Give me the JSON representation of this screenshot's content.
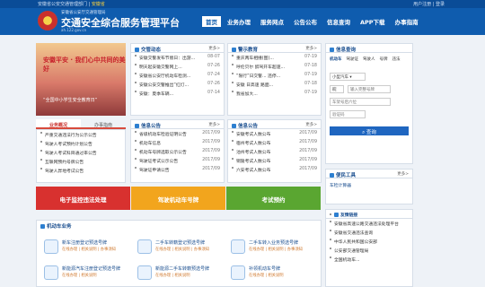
{
  "topbar": {
    "left_prefix": "安徽省公安交通管理部门",
    "left_highlight": "安徽省",
    "right": "用户注册 | 登录"
  },
  "header": {
    "sub": "安徽省公安厅交通管理局",
    "title": "交通安全综合服务管理平台",
    "url": "ah.122.gov.cn"
  },
  "nav": [
    "首页",
    "业务办理",
    "服务网点",
    "公告公布",
    "信息查询",
    "APP下载",
    "办事指南"
  ],
  "banner": {
    "main": "安徽平安 · 我们心中共同的美好",
    "sub": "“全国中小学生安全教育日”"
  },
  "tabs": [
    "业务概况",
    "办事指南"
  ],
  "panels": {
    "news": {
      "title": "交管动态",
      "more": "更多>",
      "items": [
        [
          "安徽交警发布节假日：出游...",
          "08-07"
        ],
        [
          "明天起安徽交警网上...",
          "07-26"
        ],
        [
          "安徽省公安厅机动车检测...",
          "07-24"
        ],
        [
          "安徽公安交警推出“红灯...",
          "07-26"
        ],
        [
          "安徽：夏季车辆...",
          "07-14"
        ]
      ]
    },
    "warn": {
      "title": "警示教育",
      "more": "更多>",
      "items": [
        [
          "重庆两车相撞(图)...",
          "07-19"
        ],
        [
          "呼伦贝尔 醉驾开车超速...",
          "07-18"
        ],
        [
          "“限行”日交警... 违停...",
          "07-19"
        ],
        [
          "安徽 日高速 路面...",
          "07-18"
        ],
        [
          "我省加大...",
          "07-19"
        ]
      ]
    },
    "notice_left": {
      "items": [
        [
          "严重交通违法行为公示公告",
          "2017/09"
        ],
        [
          "驾驶人考试预约计划公告",
          "2017/09"
        ],
        [
          "驾驶人考试科目通过率公告",
          "2017/09"
        ],
        [
          "互联网预约号牌公告",
          "2017/09"
        ],
        [
          "驾驶人异地考试公告",
          "2017/09"
        ]
      ]
    },
    "info": {
      "title": "信息公告",
      "more": "更多>",
      "items": [
        [
          "省级机动车检验证明公告",
          "2017/09"
        ],
        [
          "机动车信息",
          "2017/09"
        ],
        [
          "机动车号牌选取公示公告",
          "2017/09"
        ],
        [
          "驾驶证考试公示公告",
          "2017/09"
        ],
        [
          "驾驶证申请公告",
          "2017/09"
        ]
      ]
    },
    "info2": {
      "title": "信息公告",
      "more": "更多>",
      "items": [
        [
          "安徽考试人数公布",
          "2017/09"
        ],
        [
          "宿州考试人数公布",
          "2017/09"
        ],
        [
          "池州考试人数公布",
          "2017/09"
        ],
        [
          "铜陵考试人数公布",
          "2017/09"
        ],
        [
          "六安考试人数公布",
          "2017/09"
        ]
      ]
    }
  },
  "bars": [
    {
      "label": "电子监控违法处理",
      "color": "#d8312f"
    },
    {
      "label": "驾驶机动车号牌",
      "color": "#f2a51d"
    },
    {
      "label": "考试预约",
      "color": "#5aa631"
    }
  ],
  "query": {
    "title": "信息查询",
    "tabs": [
      "机动车",
      "驾驶证",
      "驾驶人",
      "号牌",
      "违法"
    ],
    "select": "小型汽车",
    "prefix": "皖",
    "plate_ph": "输入完整号牌",
    "vin_ph": "车架号后六位",
    "code_ph": "验证码",
    "button": "查询"
  },
  "links": {
    "title": "便民工具",
    "more": "更多>",
    "items": [
      "车检计算器"
    ]
  },
  "friends": {
    "title": "友情链接",
    "items": [
      "安徽省高速公路交通违法处理平台",
      "安徽省交通违法查询",
      "中华人民共和国公安部",
      "公安部交通管理局",
      "全国机动车..."
    ]
  },
  "svc": {
    "title": "机动车业务",
    "items": [
      {
        "name": "新车注册登记预选号牌",
        "links": "在线办理 | 相关说明 | 办事须知"
      },
      {
        "name": "二手车转籍登记预选号牌",
        "links": "在线办理 | 相关说明 | 办事须知"
      },
      {
        "name": "二手车转入业务预选号牌",
        "links": "在线办理 | 相关说明 | 办事须知"
      },
      {
        "name": "新能源汽车注册登记预选号牌",
        "links": "在线办理 | 相关说明"
      },
      {
        "name": "新能源二手车转籍预选号牌",
        "links": "在线办理 | 相关说明"
      },
      {
        "name": "补领机动车号牌",
        "links": "在线办理 | 相关说明"
      }
    ]
  }
}
